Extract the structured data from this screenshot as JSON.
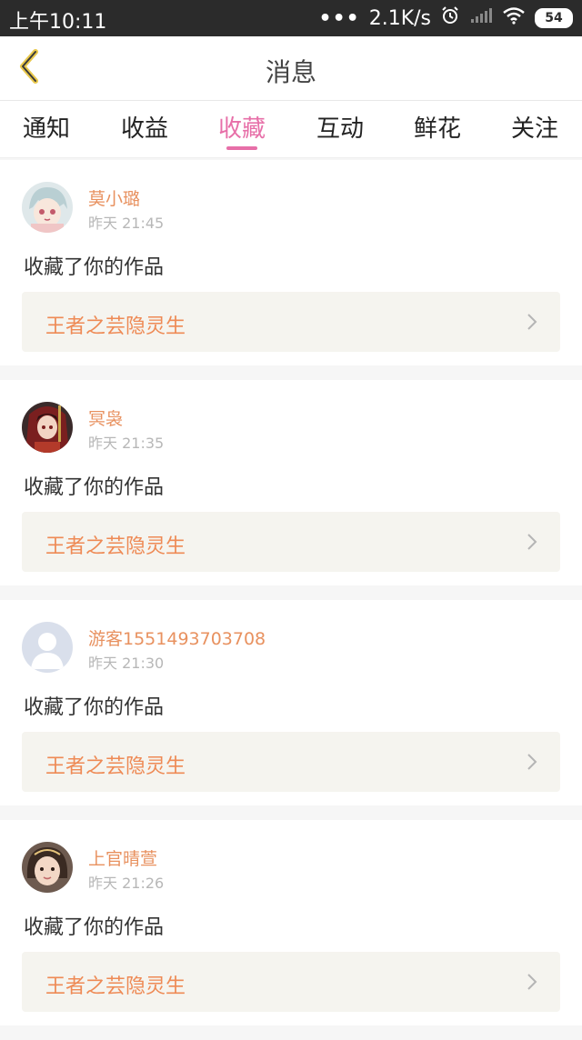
{
  "status_bar": {
    "time": "上午10:11",
    "dots": "•••",
    "speed": "2.1K/s",
    "battery": "54"
  },
  "header": {
    "title": "消息"
  },
  "tabs": [
    {
      "label": "通知"
    },
    {
      "label": "收益"
    },
    {
      "label": "收藏"
    },
    {
      "label": "互动"
    },
    {
      "label": "鲜花"
    },
    {
      "label": "关注"
    }
  ],
  "active_tab": "收藏",
  "items": [
    {
      "name": "莫小璐",
      "time": "昨天 21:45",
      "action": "收藏了你的作品",
      "work": "王者之芸隐灵生"
    },
    {
      "name": "冥袅",
      "time": "昨天 21:35",
      "action": "收藏了你的作品",
      "work": "王者之芸隐灵生"
    },
    {
      "name": "游客1551493703708",
      "time": "昨天 21:30",
      "action": "收藏了你的作品",
      "work": "王者之芸隐灵生"
    },
    {
      "name": "上官晴萱",
      "time": "昨天 21:26",
      "action": "收藏了你的作品",
      "work": "王者之芸隐灵生"
    }
  ],
  "colors": {
    "accent": "#e76fa8",
    "name": "#e8915f",
    "work_title": "#ee8a55"
  }
}
